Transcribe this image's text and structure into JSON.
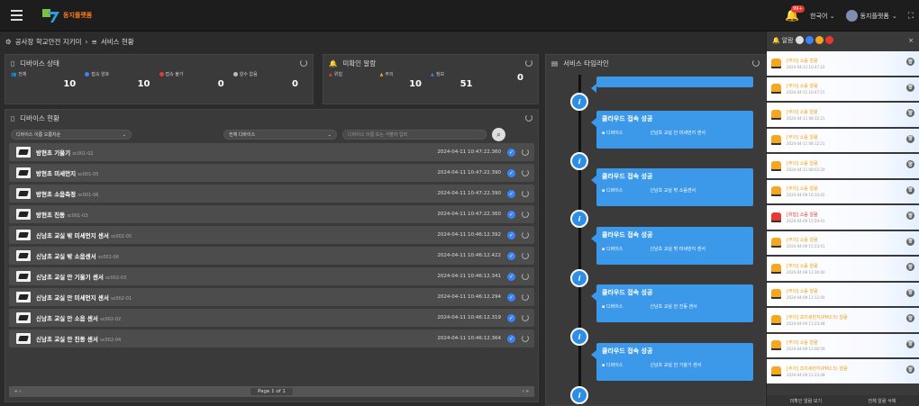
{
  "topbar": {
    "brand": "동지플랫폼",
    "notification_count": "99+",
    "language": "한국어",
    "user": "동지플랫폼"
  },
  "breadcrumb": {
    "site": "공사장 학교안전 지키미",
    "page": "서비스 현황"
  },
  "device_status": {
    "title": "디바이스 상태",
    "items": [
      {
        "label": "전체",
        "value": "10",
        "color": "#3b82f6"
      },
      {
        "label": "접속 양호",
        "value": "10",
        "color": "#3b82f6"
      },
      {
        "label": "접속 불가",
        "value": "0",
        "color": "#e53935"
      },
      {
        "label": "알수 없음",
        "value": "0",
        "color": "#bbbbbb"
      }
    ]
  },
  "unconfirmed": {
    "title": "미확인 알람",
    "items": [
      {
        "label": "위험",
        "value": "",
        "color": "#e53935"
      },
      {
        "label": "주의",
        "value": "10",
        "color": "#f5a623"
      },
      {
        "label": "정보",
        "value": "51",
        "color": "#3b82f6"
      },
      {
        "label": "",
        "value": "0",
        "color": ""
      }
    ]
  },
  "timeline": {
    "title": "서비스 타임라인",
    "cards": [
      {
        "head": "클라우드 접속 성공",
        "dev_label": "디바이스",
        "dev": "신남초 교실 안 미세먼지 센서"
      },
      {
        "head": "클라우드 접속 성공",
        "dev_label": "디바이스",
        "dev": "신남초 교실 밖 소음센서"
      },
      {
        "head": "클라우드 접속 성공",
        "dev_label": "디바이스",
        "dev": "신남초 교실 밖 미세먼지 센서"
      },
      {
        "head": "클라우드 접속 성공",
        "dev_label": "디바이스",
        "dev": "신남초 교실 안 진동 센서"
      },
      {
        "head": "클라우드 접속 성공",
        "dev_label": "디바이스",
        "dev": "신남초 교실 안 기울기 센서"
      }
    ]
  },
  "device_list": {
    "title": "디바이스 현황",
    "filter1": "디바이스 이름 오름차순",
    "filter2": "전체 디바이스",
    "search_placeholder": "디바이스 이름 또는 식별자 입력",
    "pager": "Page 1 of 1",
    "rows": [
      {
        "name": "방현초 기울기",
        "id": "sc001-02",
        "time": "2024-04-11 10:47:22.360"
      },
      {
        "name": "방현초 미세먼지",
        "id": "sc001-05",
        "time": "2024-04-11 10:47:22.390"
      },
      {
        "name": "방현초 소음측정",
        "id": "sc001-06",
        "time": "2024-04-11 10:47:22.390"
      },
      {
        "name": "방현초 진동",
        "id": "sc001-03",
        "time": "2024-04-11 10:47:22.360"
      },
      {
        "name": "신남초 교실 밖 미세먼지 센서",
        "id": "sc002-05",
        "time": "2024-04-11 10:46:12.392"
      },
      {
        "name": "신남초 교실 밖 소음센서",
        "id": "sc002-06",
        "time": "2024-04-11 10:46:12.422"
      },
      {
        "name": "신남초 교실 안 기울기 센서",
        "id": "sc002-03",
        "time": "2024-04-11 10:46:12.341"
      },
      {
        "name": "신남초 교실 안 미세먼지 센서",
        "id": "sc002-01",
        "time": "2024-04-11 10:46:12.294"
      },
      {
        "name": "신남초 교실 안 소음 센서",
        "id": "sc002-02",
        "time": "2024-04-11 10:46:12.319"
      },
      {
        "name": "신남초 교실 안 진동 센서",
        "id": "sc002-04",
        "time": "2024-04-11 10:46:12.364"
      }
    ]
  },
  "alarms": {
    "title": "알람",
    "footer_left": "미확인 알람 보기",
    "footer_right": "전체 알람 삭제",
    "items": [
      {
        "title": "[주의] 소음 알람",
        "time": "2024-04-11 10:47:22",
        "level": "warn"
      },
      {
        "title": "[주의] 소음 알람",
        "time": "2024-04-11 10:47:21",
        "level": "warn"
      },
      {
        "title": "[주의] 소음 알람",
        "time": "2024-04-11 08:32:21",
        "level": "warn"
      },
      {
        "title": "[주의] 소음 알람",
        "time": "2024-04-11 08:12:21",
        "level": "warn"
      },
      {
        "title": "[주의] 소음 알람",
        "time": "2024-04-11 08:02:20",
        "level": "warn"
      },
      {
        "title": "[주의] 소음 알람",
        "time": "2024-04-09 16:10:42",
        "level": "warn"
      },
      {
        "title": "[위험] 소음 알람",
        "time": "2024-04-09 15:59:41",
        "level": "danger"
      },
      {
        "title": "[주의] 소음 알람",
        "time": "2024-04-09 15:23:41",
        "level": "warn"
      },
      {
        "title": "[주의] 소음 알람",
        "time": "2024-04-09 12:30:40",
        "level": "warn"
      },
      {
        "title": "[주의] 소음 알람",
        "time": "2024-04-09 12:12:40",
        "level": "warn"
      },
      {
        "title": "[주의] 초미세먼지(PM2.5) 알람",
        "time": "2024-04-09 11:23:48",
        "level": "warn"
      },
      {
        "title": "[주의] 소음 알람",
        "time": "2024-04-09 11:00:59",
        "level": "warn"
      },
      {
        "title": "[주의] 초미세먼지(PM2.5) 알람",
        "time": "2024-04-09 11:23:48",
        "level": "warn"
      }
    ]
  }
}
